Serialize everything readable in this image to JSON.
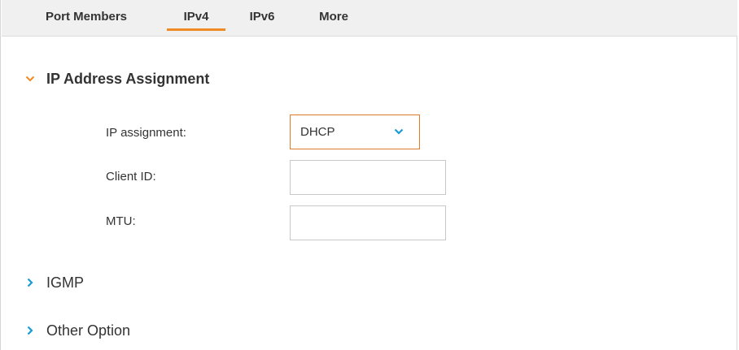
{
  "tabs": [
    {
      "label": "Port Members"
    },
    {
      "label": "IPv4",
      "active": true
    },
    {
      "label": "IPv6"
    },
    {
      "label": "More"
    }
  ],
  "sections": {
    "ip_address_assignment": {
      "title": "IP Address Assignment",
      "expanded": true,
      "fields": {
        "ip_assignment": {
          "label": "IP assignment:",
          "value": "DHCP"
        },
        "client_id": {
          "label": "Client ID:",
          "value": "",
          "placeholder": ""
        },
        "mtu": {
          "label": "MTU:",
          "value": "",
          "placeholder": ""
        }
      }
    },
    "igmp": {
      "title": "IGMP",
      "expanded": false
    },
    "other_option": {
      "title": "Other Option",
      "expanded": false
    }
  },
  "icons": {
    "expanded_chevron": "chevron-down-icon",
    "collapsed_chevron": "chevron-right-icon",
    "select_chevron": "chevron-down-icon"
  },
  "colors": {
    "accent_orange": "#f08a24",
    "select_border": "#e07b2c",
    "chevron_blue": "#1a9ad6",
    "tabbar_bg": "#f0f0f0"
  }
}
